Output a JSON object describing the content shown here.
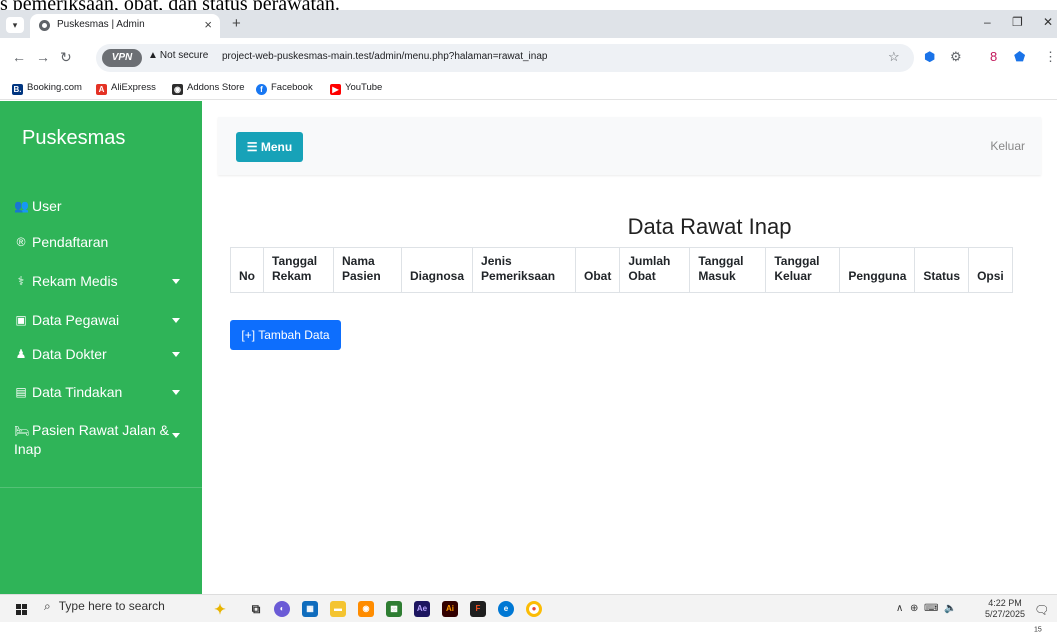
{
  "caption_fragment": "s pemeriksaan, obat, dan status perawatan.",
  "browser": {
    "tab_title": "Puskesmas | Admin",
    "tab_close": "×",
    "new_tab": "+",
    "vpn_label": "VPN",
    "security_label": "Not secure",
    "url": "project-web-puskesmas-main.test/admin/menu.php?halaman=rawat_inap",
    "win_minimize": "–",
    "win_restore": "❐",
    "win_close": "✕"
  },
  "bookmarks": [
    {
      "label": "Booking.com",
      "color": "#003580",
      "glyph": "B."
    },
    {
      "label": "AliExpress",
      "color": "#e43225",
      "glyph": "A"
    },
    {
      "label": "Addons Store",
      "color": "#2d2d2d",
      "glyph": "◉"
    },
    {
      "label": "Facebook",
      "color": "#1877f2",
      "glyph": "f"
    },
    {
      "label": "YouTube",
      "color": "#ff0000",
      "glyph": "▶"
    }
  ],
  "sidebar": {
    "brand": "Puskesmas",
    "items": [
      {
        "label": "User",
        "icon": "users-icon",
        "glyph": "👥",
        "has_caret": false
      },
      {
        "label": "Pendaftaran",
        "icon": "registered-icon",
        "glyph": "®",
        "has_caret": false
      },
      {
        "label": "Rekam Medis",
        "icon": "stethoscope-icon",
        "glyph": "⚕",
        "has_caret": true
      },
      {
        "label": "Data Pegawai",
        "icon": "id-card-icon",
        "glyph": "▣",
        "has_caret": true
      },
      {
        "label": "Data Dokter",
        "icon": "doctor-icon",
        "glyph": "♟",
        "has_caret": true
      },
      {
        "label": "Data Tindakan",
        "icon": "clipboard-icon",
        "glyph": "▤",
        "has_caret": true
      },
      {
        "label": "Pasien Rawat Jalan & Inap",
        "icon": "bed-icon",
        "glyph": "🛏",
        "has_caret": true
      }
    ]
  },
  "topbar": {
    "menu_label": "Menu",
    "logout_label": "Keluar"
  },
  "page": {
    "title": "Data Rawat Inap",
    "add_button": "[+] Tambah Data"
  },
  "table": {
    "headers": [
      "No",
      "Tanggal Rekam",
      "Nama Pasien",
      "Diagnosa",
      "Jenis Pemeriksaan",
      "Obat",
      "Jumlah Obat",
      "Tanggal Masuk",
      "Tanggal Keluar",
      "Pengguna",
      "Status",
      "Opsi"
    ]
  },
  "taskbar": {
    "search_placeholder": "Type here to search",
    "time": "4:22 PM",
    "date": "5/27/2025",
    "notification_count": "15"
  },
  "colors": {
    "sidebar": "#2fb458",
    "menu_button": "#17a2b8",
    "add_button": "#0d6efd"
  }
}
